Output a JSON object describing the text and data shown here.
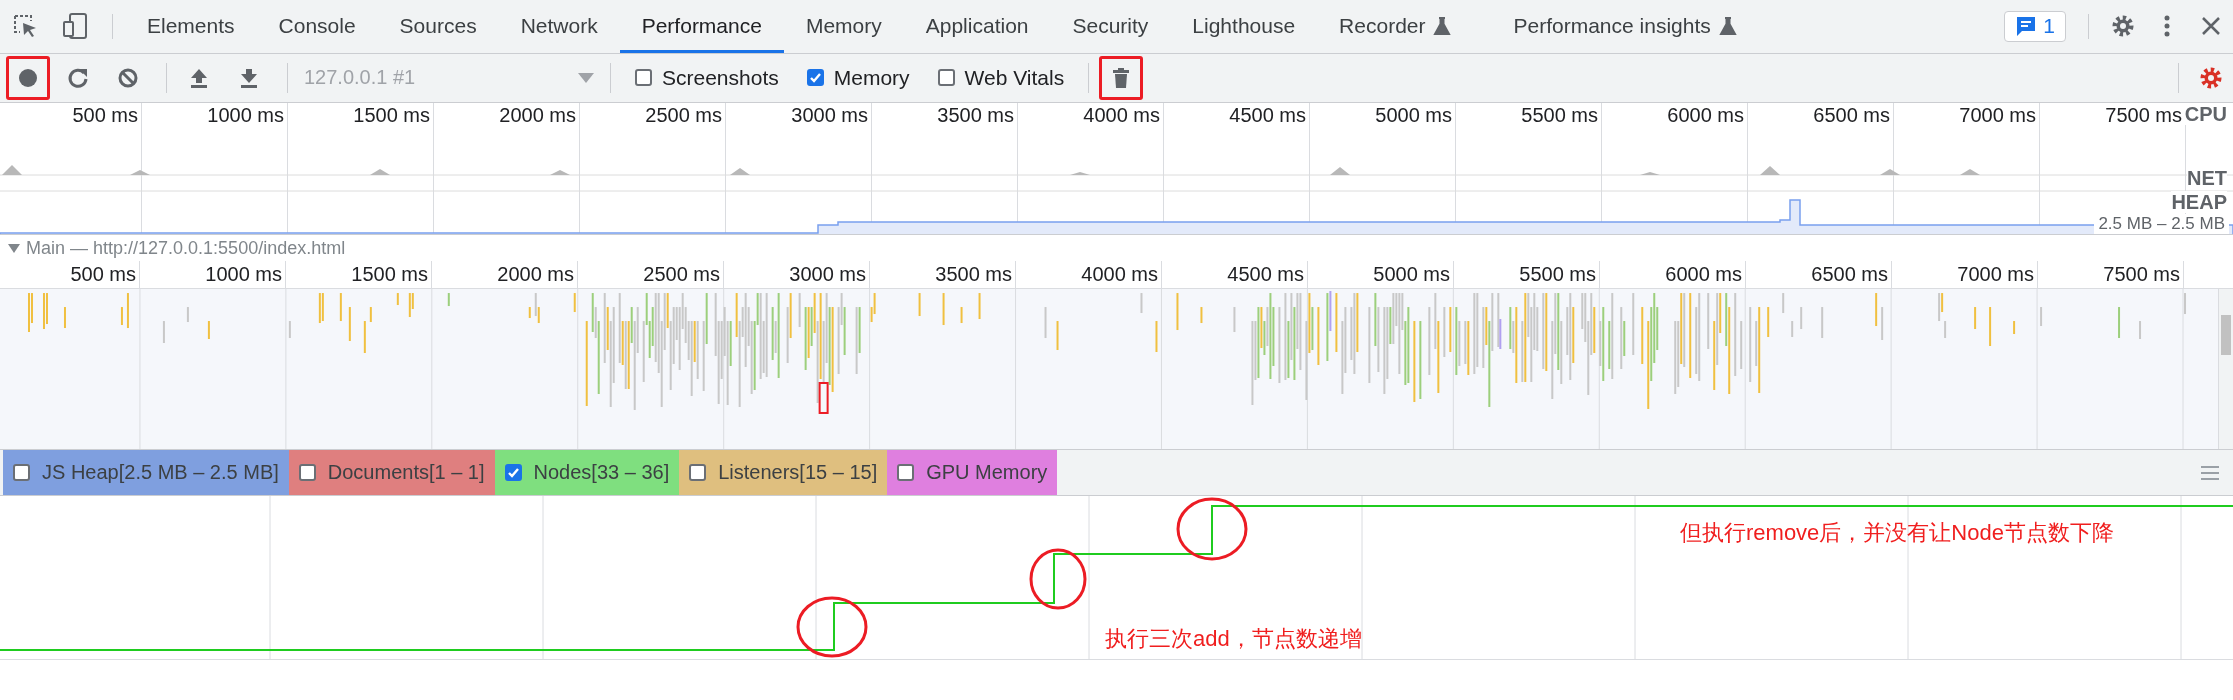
{
  "tabs": [
    {
      "label": "Elements",
      "selected": false,
      "experimental": false
    },
    {
      "label": "Console",
      "selected": false,
      "experimental": false
    },
    {
      "label": "Sources",
      "selected": false,
      "experimental": false
    },
    {
      "label": "Network",
      "selected": false,
      "experimental": false
    },
    {
      "label": "Performance",
      "selected": true,
      "experimental": false
    },
    {
      "label": "Memory",
      "selected": false,
      "experimental": false
    },
    {
      "label": "Application",
      "selected": false,
      "experimental": false
    },
    {
      "label": "Security",
      "selected": false,
      "experimental": false
    },
    {
      "label": "Lighthouse",
      "selected": false,
      "experimental": false
    },
    {
      "label": "Recorder",
      "selected": false,
      "experimental": true
    },
    {
      "label": "Performance insights",
      "selected": false,
      "experimental": true
    }
  ],
  "issues": {
    "count": "1"
  },
  "toolbar": {
    "buttons": [
      {
        "kind": "record",
        "highlighted": true
      },
      {
        "kind": "reload",
        "highlighted": false
      },
      {
        "kind": "clear",
        "highlighted": false
      },
      {
        "kind": "upload",
        "highlighted": false
      },
      {
        "kind": "download",
        "highlighted": false
      }
    ],
    "target": {
      "value": "127.0.0.1 #1",
      "disabled": true
    },
    "options": [
      {
        "label": "Screenshots",
        "checked": false
      },
      {
        "label": "Memory",
        "checked": true
      },
      {
        "label": "Web Vitals",
        "checked": false
      }
    ],
    "buttons_after": [
      {
        "kind": "trash",
        "highlighted": true
      }
    ],
    "settings_modified": true
  },
  "overview": {
    "ticks": [
      "500 ms",
      "1000 ms",
      "1500 ms",
      "2000 ms",
      "2500 ms",
      "3000 ms",
      "3500 ms",
      "4000 ms",
      "4500 ms",
      "5000 ms",
      "5500 ms",
      "6000 ms",
      "6500 ms",
      "7000 ms",
      "7500 ms"
    ],
    "tracks": [
      "CPU",
      "NET",
      "HEAP"
    ],
    "heap_range": "2.5 MB – 2.5 MB"
  },
  "main_track": {
    "title": "Main — http://127.0.0.1:5500/index.html",
    "expanded": true,
    "ticks": [
      "500 ms",
      "1000 ms",
      "1500 ms",
      "2000 ms",
      "2500 ms",
      "3000 ms",
      "3500 ms",
      "4000 ms",
      "4500 ms",
      "5000 ms",
      "5500 ms",
      "6000 ms",
      "6500 ms",
      "7000 ms",
      "7500 ms"
    ]
  },
  "counters": [
    {
      "label": "JS Heap[2.5 MB – 2.5 MB]",
      "checked": false,
      "color": "#7f9fdf"
    },
    {
      "label": "Documents[1 – 1]",
      "checked": false,
      "color": "#df7f7f"
    },
    {
      "label": "Nodes[33 – 36]",
      "checked": true,
      "color": "#7fdf7f"
    },
    {
      "label": "Listeners[15 – 15]",
      "checked": false,
      "color": "#dfbf7f"
    },
    {
      "label": "GPU Memory",
      "checked": false,
      "color": "#df7fdf"
    }
  ],
  "annotations": [
    {
      "text": "执行三次add，节点数递增"
    },
    {
      "text": "但执行remove后，并没有让Node节点数下降"
    }
  ]
}
